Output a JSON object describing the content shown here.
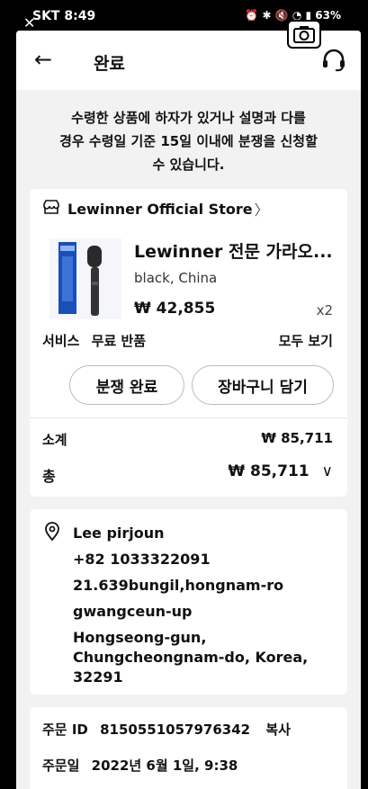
{
  "status_bar": {
    "carrier": "SKT",
    "time": "8:49",
    "battery": "63%"
  },
  "header": {
    "title": "완료"
  },
  "notice": {
    "line1": "수령한 상품에 하자가 있거나 설명과 다를",
    "line2": "경우 수령일 기준 15일 이내에 분쟁을 신청할",
    "line3": "수 있습니다."
  },
  "store": {
    "name": "Lewinner Official Store",
    "product_name": "Lewinner 전문 가라오...",
    "variant": "black, China",
    "price": "₩ 42,855",
    "quantity": "x2",
    "service_label": "서비스",
    "service_value": "무료 반품",
    "see_all": "모두 보기",
    "dispute_button": "분쟁 완료",
    "cart_button": "장바구니 담기",
    "subtotal_label": "소계",
    "subtotal_value": "₩ 85,711",
    "total_label": "총",
    "total_value": "₩ 85,711"
  },
  "address": {
    "name": "Lee pirjoun",
    "phone": "+82 1033322091",
    "line1": "21.639bungil,hongnam-ro",
    "line2": "gwangceun-up",
    "line3a": "Hongseong-gun,",
    "line3b": "Chungcheongnam-do, Korea,",
    "line3c": "32291"
  },
  "order": {
    "id_label": "주문 ID",
    "id_value": "8150551057976342",
    "copy_label": "복사",
    "date_label": "주문일",
    "date_value": "2022년 6월 1일, 9:38"
  }
}
